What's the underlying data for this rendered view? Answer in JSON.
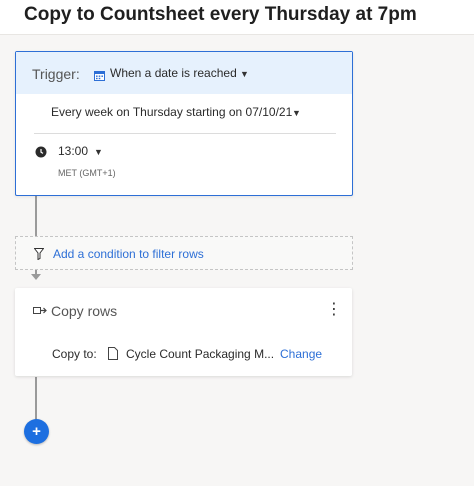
{
  "page": {
    "title": "Copy to Countsheet every Thursday at 7pm"
  },
  "trigger": {
    "label": "Trigger:",
    "type": "When a date is reached",
    "type_icon": "calendar-icon",
    "schedule": "Every week on Thursday starting on 07/10/21",
    "time": "13:00",
    "time_icon": "clock-icon",
    "timezone": "MET (GMT+1)"
  },
  "condition": {
    "label": "Add a condition to filter rows",
    "icon": "filter-icon"
  },
  "action": {
    "title": "Copy rows",
    "title_icon": "copy-rows-icon",
    "menu_icon": "more-vertical-icon",
    "copy_to_label": "Copy to:",
    "target_icon": "sheet-icon",
    "target": "Cycle Count Packaging M...",
    "change_label": "Change"
  },
  "add_button": {
    "label": "+"
  },
  "colors": {
    "accent": "#2d6fd6",
    "trigger_bg": "#e6f1fd",
    "add_button": "#1d6fe0"
  }
}
